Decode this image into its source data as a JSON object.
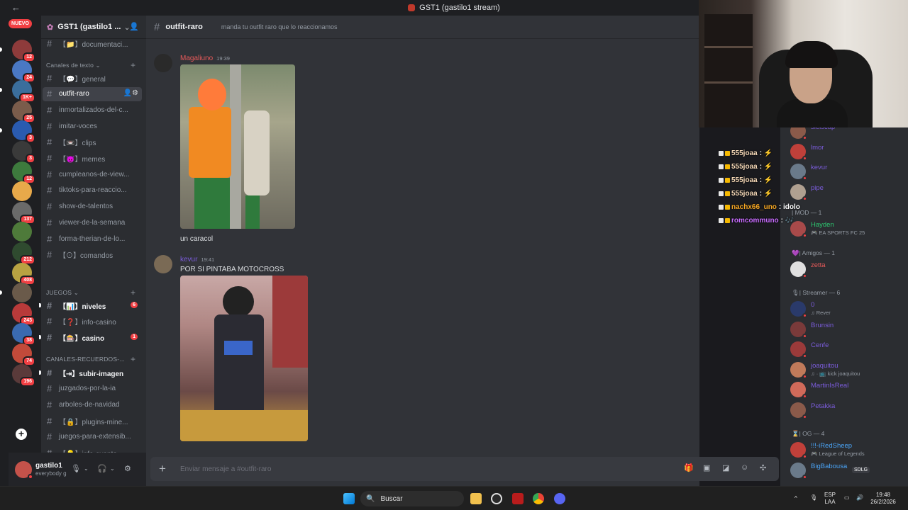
{
  "window": {
    "title": "GST1 (gastilo1 stream)",
    "back": "←"
  },
  "servers": {
    "new_label": "NUEVO",
    "badges": [
      "12",
      "24",
      "1K+",
      "25",
      "3",
      "3",
      "12",
      "",
      "137",
      "",
      "212",
      "408",
      "",
      "243",
      "38",
      "74",
      "196"
    ]
  },
  "guild": {
    "name": "GST1 (gastilo1 ...",
    "chevron": "⌄"
  },
  "channels": {
    "top": "【📁】documentaci...",
    "cat_text": "Canales de texto ⌄",
    "items": [
      "【💬】general",
      "outfit-raro",
      "inmortalizados-del-c...",
      "imitar-voces",
      "【📼】clips",
      "【😈】memes",
      "cumpleanos-de-view...",
      "tiktoks-para-reaccio...",
      "show-de-talentos",
      "viewer-de-la-semana",
      "forma-therian-de-lo...",
      "【⊙】comandos"
    ],
    "cat_games": "JUEGOS ⌄",
    "games": [
      "【📊】niveles",
      "【❓】info-casino",
      "【🎰】casino"
    ],
    "games_counts": [
      "6",
      "",
      "1"
    ],
    "cat_memories": "CANALES-RECUERDOS-...",
    "memories": [
      "【⇥】subir-imagen",
      "juzgados-por-la-ia",
      "arboles-de-navidad",
      "【🔒】plugins-mine...",
      "juegos-para-extensib...",
      "【💡】info-evento"
    ]
  },
  "user": {
    "name": "gastilo1",
    "status": "everybody g"
  },
  "chat": {
    "channel": "outfit-raro",
    "topic": "manda tu outfit raro que lo reaccionamos",
    "messages": [
      {
        "author": "Magaliuno",
        "time": "19:39",
        "text": "un caracol",
        "color": "#e85a5a"
      },
      {
        "author": "kevur",
        "time": "19:41",
        "text": "POR SI PINTABA MOTOCROSS",
        "color": "#7b5cdb"
      }
    ],
    "placeholder": "Enviar mensaje a #outfit-raro"
  },
  "stream_chat": [
    {
      "user": "555joaa",
      "msg": ": ⚡"
    },
    {
      "user": "555joaa",
      "msg": ": ⚡"
    },
    {
      "user": "555joaa",
      "msg": ": ⚡"
    },
    {
      "user": "555joaa",
      "msg": ": ⚡"
    },
    {
      "user": "nachx66_uno",
      "msg": ": idolo"
    },
    {
      "user": "romcommuno",
      "msg": ": 🎶"
    }
  ],
  "members": {
    "top": [
      {
        "name": "slelscap",
        "color": "#7b5cdb"
      },
      {
        "name": "lmor",
        "color": "#7b5cdb"
      },
      {
        "name": "kevur",
        "color": "#7b5cdb"
      },
      {
        "name": "pipe",
        "color": "#7b5cdb"
      }
    ],
    "mod_head": "| MOD — 1",
    "mod": [
      {
        "name": "Hayden",
        "sub": "🎮 EA SPORTS FC 25",
        "color": "#2dc770"
      }
    ],
    "friends_head": "💜| Amigos — 1",
    "friends": [
      {
        "name": "zetta",
        "sub": "",
        "color": "#e85a5a"
      }
    ],
    "streamer_head": "🎙| Streamer — 6",
    "streamers": [
      {
        "name": "0",
        "sub": "♫ Rever",
        "color": "#7b5cdb"
      },
      {
        "name": "Brunsin",
        "sub": "",
        "color": "#7b5cdb"
      },
      {
        "name": "Cenfe",
        "sub": "",
        "color": "#7b5cdb"
      },
      {
        "name": "joaquitou",
        "sub": "♫ · 📺 kick joaquitou",
        "color": "#7b5cdb"
      },
      {
        "name": "MartinIsReal",
        "sub": "",
        "color": "#7b5cdb"
      },
      {
        "name": "Petakka",
        "sub": "",
        "color": "#7b5cdb"
      }
    ],
    "og_head": "⌛| OG — 4",
    "og": [
      {
        "name": "!!!-iRedSheep",
        "sub": "🎮 League of Legends",
        "color": "#4aa3f5"
      },
      {
        "name": "BigBabousa",
        "sub": "",
        "color": "#4aa3f5"
      }
    ],
    "tag": "SDLG"
  },
  "taskbar": {
    "search": "Buscar",
    "lang": "ESP",
    "lang2": "LAA",
    "time": "19:48",
    "date": "26/2/2026"
  }
}
